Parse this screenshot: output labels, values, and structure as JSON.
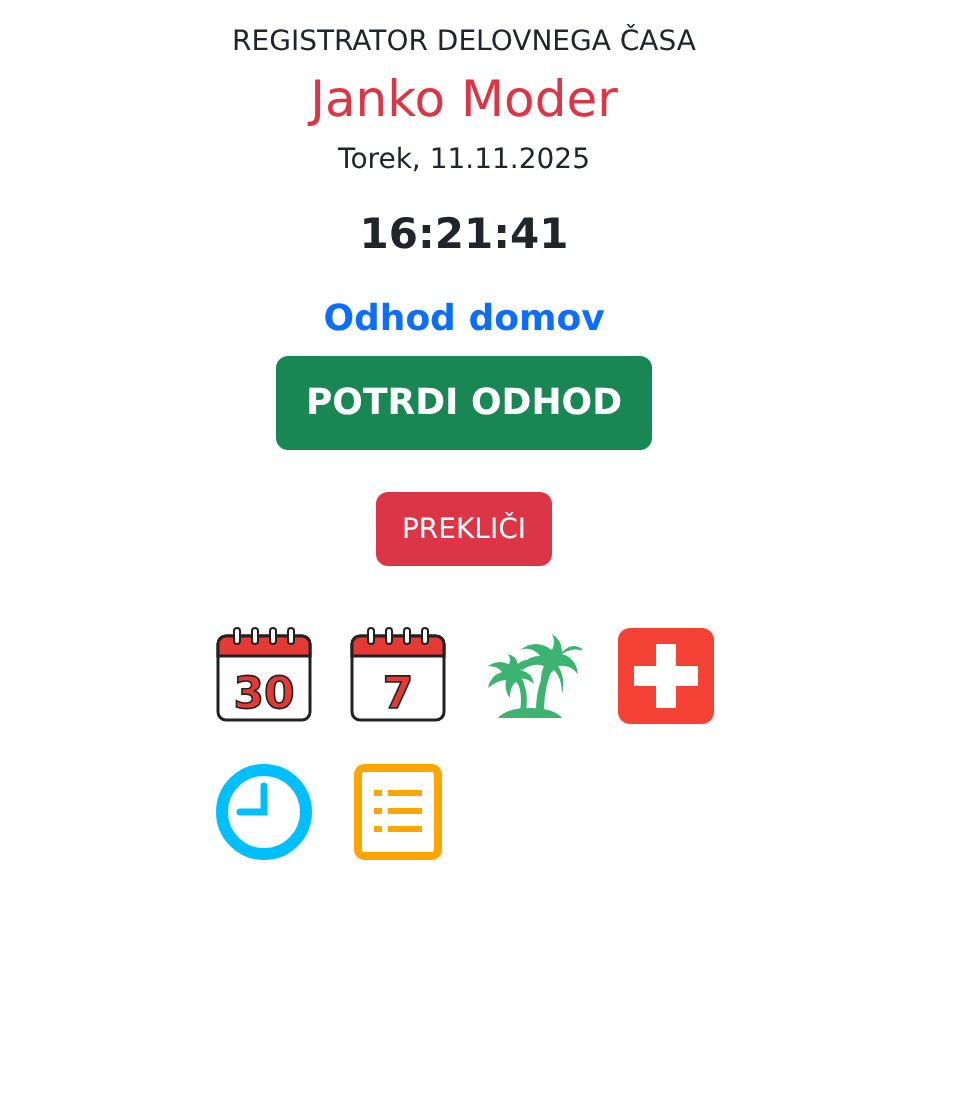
{
  "header": {
    "app_title": "REGISTRATOR DELOVNEGA ČASA",
    "user_name": "Janko Moder",
    "date": "Torek, 11.11.2025",
    "time": "16:21:41"
  },
  "action": {
    "label": "Odhod domov",
    "confirm_button": "POTRDI ODHOD",
    "cancel_button": "PREKLIČI"
  },
  "shortcuts": [
    {
      "kind": "calendar",
      "text": "30"
    },
    {
      "kind": "calendar",
      "text": "7"
    },
    {
      "kind": "palm"
    },
    {
      "kind": "medical"
    },
    {
      "kind": "clock"
    },
    {
      "kind": "list"
    }
  ]
}
